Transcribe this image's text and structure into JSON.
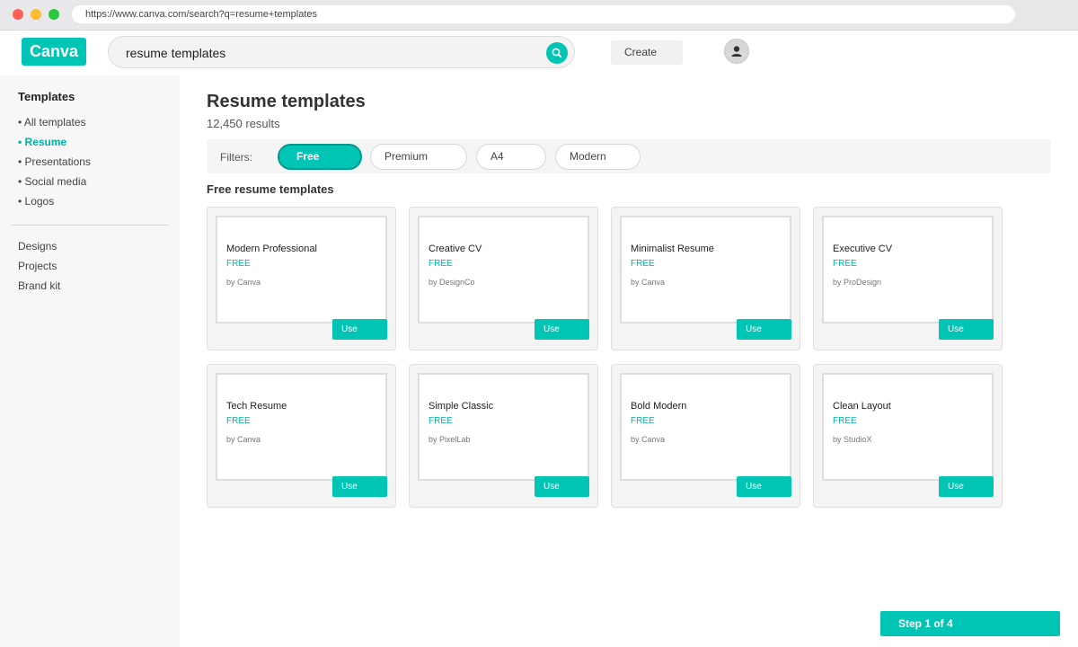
{
  "browser": {
    "url": "https://www.canva.com/search?q=resume+templates"
  },
  "header": {
    "logo": "Canva",
    "search_value": "resume templates",
    "create_label": "Create"
  },
  "sidebar": {
    "title": "Templates",
    "items": [
      {
        "label": "• All templates",
        "active": false
      },
      {
        "label": "• Resume",
        "active": true
      },
      {
        "label": "• Presentations",
        "active": false
      },
      {
        "label": "• Social media",
        "active": false
      },
      {
        "label": "• Logos",
        "active": false
      }
    ],
    "links": [
      "Designs",
      "Projects",
      "Brand kit"
    ]
  },
  "main": {
    "title": "Resume templates",
    "results": "12,450 results",
    "filters_label": "Filters:",
    "filters": [
      {
        "label": "Free",
        "active": true
      },
      {
        "label": "Premium",
        "active": false
      },
      {
        "label": "A4",
        "active": false
      },
      {
        "label": "Modern",
        "active": false
      }
    ],
    "section_title": "Free resume templates",
    "cards": [
      {
        "name": "Modern Professional",
        "badge": "FREE",
        "author": "by Canva",
        "button": "Use"
      },
      {
        "name": "Creative CV",
        "badge": "FREE",
        "author": "by DesignCo",
        "button": "Use"
      },
      {
        "name": "Minimalist Resume",
        "badge": "FREE",
        "author": "by Canva",
        "button": "Use"
      },
      {
        "name": "Executive CV",
        "badge": "FREE",
        "author": "by ProDesign",
        "button": "Use"
      },
      {
        "name": "Tech Resume",
        "badge": "FREE",
        "author": "by Canva",
        "button": "Use"
      },
      {
        "name": "Simple Classic",
        "badge": "FREE",
        "author": "by PixelLab",
        "button": "Use"
      },
      {
        "name": "Bold Modern",
        "badge": "FREE",
        "author": "by Canva",
        "button": "Use"
      },
      {
        "name": "Clean Layout",
        "badge": "FREE",
        "author": "by StudioX",
        "button": "Use"
      }
    ]
  },
  "step_label": "Step 1 of 4",
  "colors": {
    "accent": "#00c4b4",
    "accent_dark": "#00998c"
  }
}
